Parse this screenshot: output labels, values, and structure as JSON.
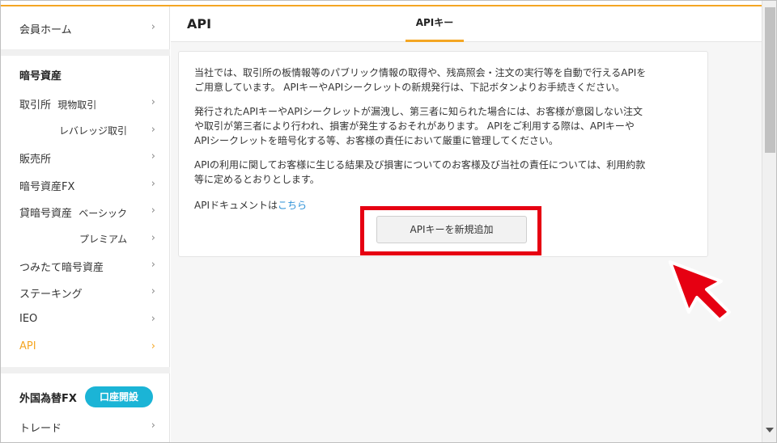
{
  "sidebar": {
    "items": [
      {
        "label": "会員ホーム"
      },
      {
        "label": "取引所",
        "sub": "現物取引"
      },
      {
        "label": "レバレッジ取引"
      },
      {
        "label": "販売所"
      },
      {
        "label": "暗号資産FX"
      },
      {
        "label": "貸暗号資産",
        "sub": "ベーシック"
      },
      {
        "label": "プレミアム"
      },
      {
        "label": "つみたて暗号資産"
      },
      {
        "label": "ステーキング"
      },
      {
        "label": "IEO"
      },
      {
        "label": "API"
      },
      {
        "label": "トレード"
      }
    ],
    "section_crypto": "暗号資産",
    "section_fx": "外国為替FX",
    "open_account": "口座開設",
    "chevron": "›"
  },
  "main": {
    "title": "API",
    "tab_label": "APIキー",
    "card": {
      "p1_line1": "当社では、取引所の板情報等のパブリック情報の取得や、残高照会・注文の実行等を自動で行えるAPIを",
      "p1_line2": "ご用意しています。 APIキーやAPIシークレットの新規発行は、下記ボタンよりお手続きください。",
      "p2_line1": "発行されたAPIキーやAPIシークレットが漏洩し、第三者に知られた場合には、お客様が意図しない注文",
      "p2_line2": "や取引が第三者により行われ、損害が発生するおそれがあります。 APIをご利用する際は、APIキーや",
      "p2_line3": "APIシークレットを暗号化する等、お客様の責任において厳重に管理してください。",
      "p3_line1": "APIの利用に関してお客様に生じる結果及び損害についてのお客様及び当社の責任については、利用約款",
      "p3_line2": "等に定めるとおりとします。",
      "doc_prefix": "APIドキュメントは",
      "doc_link": "こちら",
      "add_button": "APIキーを新規追加"
    }
  },
  "colors": {
    "accent": "#f4a623",
    "highlight": "#e60012",
    "pill": "#1bb4d6",
    "link": "#2a8fd6"
  }
}
